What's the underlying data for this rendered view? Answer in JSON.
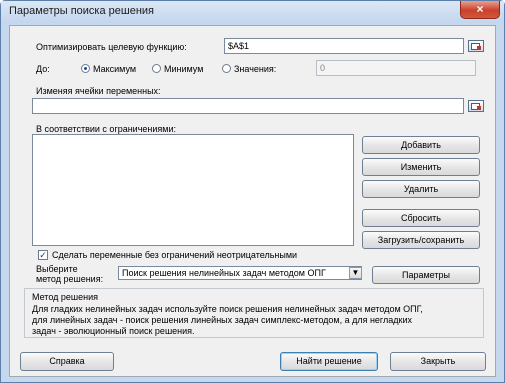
{
  "window": {
    "title": "Параметры поиска решения",
    "close_glyph": "×"
  },
  "objective": {
    "label": "Оптимизировать целевую функцию:",
    "value": "$A$1"
  },
  "to": {
    "label": "До:",
    "options": [
      {
        "label": "Максимум",
        "checked": true
      },
      {
        "label": "Минимум",
        "checked": false
      },
      {
        "label": "Значения:",
        "checked": false
      }
    ],
    "value_field": "0"
  },
  "variables": {
    "label": "Изменяя ячейки переменных:",
    "value": ""
  },
  "constraints": {
    "label": "В соответствии с ограничениями:",
    "items": [],
    "buttons": {
      "add": "Добавить",
      "change": "Изменить",
      "delete": "Удалить",
      "reset": "Сбросить",
      "load_save": "Загрузить/сохранить"
    }
  },
  "nonnegative": {
    "label": "Сделать переменные без ограничений неотрицательными",
    "checked": true,
    "check_glyph": "✓"
  },
  "method": {
    "label_line1": "Выберите",
    "label_line2": "метод решения:",
    "selected": "Поиск решения нелинейных задач методом ОПГ",
    "arrow_glyph": "▼",
    "options_button": "Параметры"
  },
  "method_info": {
    "title": "Метод решения",
    "lines": [
      "Для гладких нелинейных задач используйте поиск решения нелинейных задач методом ОПГ,",
      "для линейных задач - поиск решения линейных задач симплекс-методом, а для негладких",
      "задач - эволюционный поиск решения."
    ]
  },
  "footer": {
    "help": "Справка",
    "solve": "Найти решение",
    "close": "Закрыть"
  },
  "colors": {
    "frame": "#c5d8ee",
    "client": "#f0f0f0",
    "close_button": "#c9412b",
    "radio_dot": "#1b4f9e"
  }
}
